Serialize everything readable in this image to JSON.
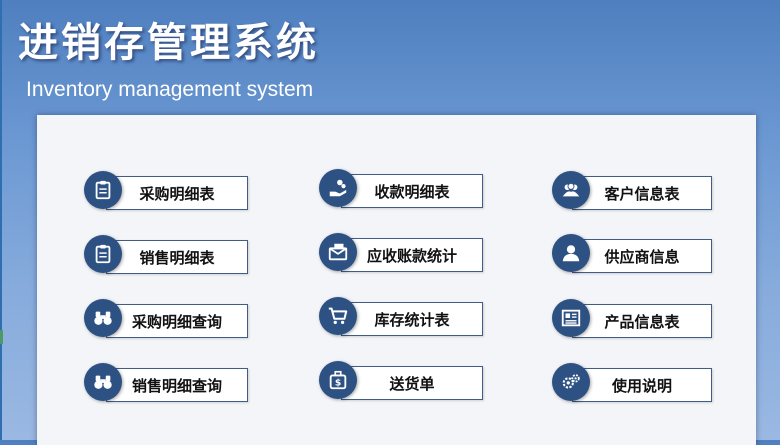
{
  "header": {
    "title": "进销存管理系统",
    "subtitle": "Inventory management system"
  },
  "buttons": {
    "purchase_detail": "采购明细表",
    "sales_detail": "销售明细表",
    "purchase_query": "采购明细查询",
    "sales_query": "销售明细查询",
    "receipt_detail": "收款明细表",
    "receivable_stats": "应收账款统计",
    "inventory_stats": "库存统计表",
    "delivery_note": "送货单",
    "customer_info": "客户信息表",
    "supplier_info": "供应商信息",
    "product_info": "产品信息表",
    "user_guide": "使用说明"
  },
  "colors": {
    "icon_circle": "#2d5183",
    "label_border": "#3f5d86",
    "background_top": "#4f7fbf",
    "panel": "#f3f5f9"
  }
}
